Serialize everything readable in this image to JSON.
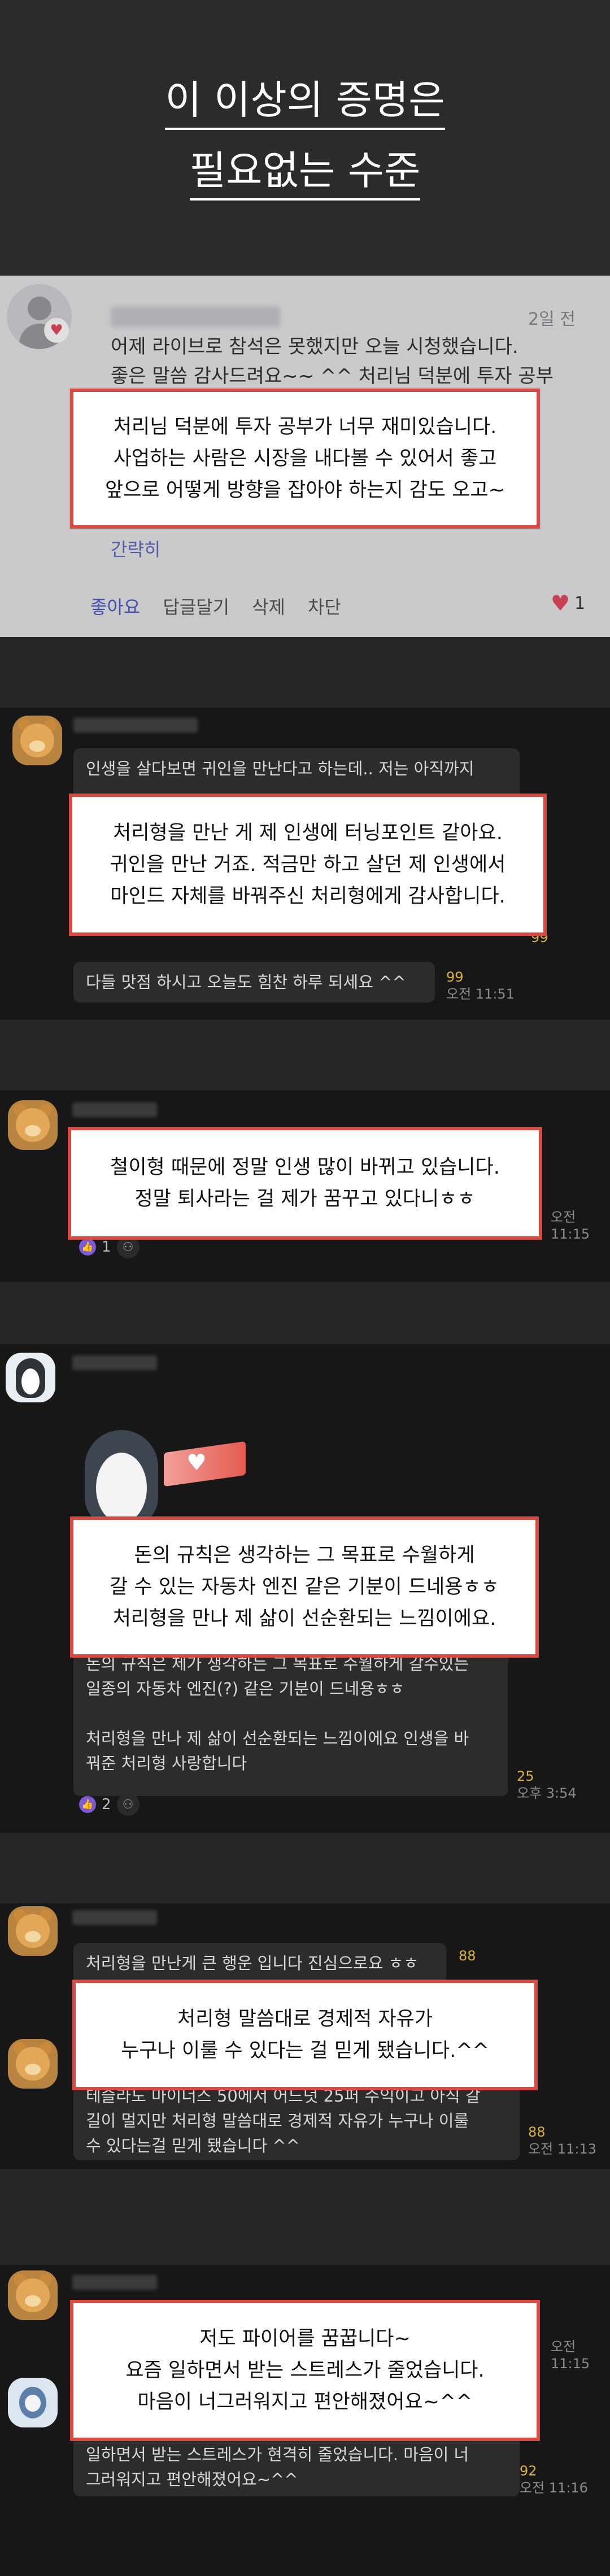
{
  "hero": {
    "line1": "이 이상의 증명은",
    "line2": "필요없는 수준"
  },
  "blog_comment": {
    "date": "2일 전",
    "text_lines": [
      "어제 라이브로 참석은 못했지만 오늘 시청했습니다.",
      "좋은 말씀 감사드려요~~ ^^ 처리님 덕분에 투자 공부",
      "",
      "",
      "",
      ""
    ],
    "fold": "간략히",
    "actions": {
      "like": "좋아요",
      "reply": "답글달기",
      "delete": "삭제",
      "block": "차단"
    },
    "like_count": "1",
    "highlight": [
      "처리님 덕분에 투자 공부가 너무 재미있습니다.",
      "사업하는 사람은 시장을 내다볼 수 있어서 좋고",
      "앞으로 어떻게 방향을 잡아야 하는지 감도 오고~"
    ]
  },
  "chat1": {
    "bubble_top": "인생을 살다보면 귀인을 만난다고 하는데.. 저는 아직까지",
    "count": "99",
    "bubble_bottom": "다들 맛점 하시고 오늘도 힘찬 하루 되세요 ^^",
    "count2": "99",
    "time2": "오전 11:51",
    "highlight": [
      "처리형을 만난 게 제 인생에 터닝포인트 같아요.",
      "귀인을 만난 거죠. 적금만 하고 살던 제 인생에서",
      "마인드 자체를 바꿔주신 처리형에게 감사합니다."
    ]
  },
  "chat2": {
    "time": "오전 11:15",
    "react_count": "1",
    "highlight": [
      "철이형 때문에 정말 인생 많이 바뀌고 있습니다.",
      "정말 퇴사라는 걸 제가 꿈꾸고 있다니ㅎㅎ"
    ]
  },
  "chat3": {
    "bubble_lines": [
      "돈의 규칙은 제가 생각하는 그 목표로 수월하게 갈수있는",
      "일종의 자동차 엔진(?) 같은 기분이 드네용ㅎㅎ",
      "",
      "처리형을 만나 제 삶이 선순환되는 느낌이에요 인생을 바",
      "꿔준 처리형 사랑합니다"
    ],
    "count": "25",
    "time": "오후 3:54",
    "react_count": "2",
    "highlight": [
      "돈의 규칙은 생각하는 그 목표로 수월하게",
      "갈 수 있는 자동차 엔진 같은 기분이 드네용ㅎㅎ",
      "처리형을 만나 제 삶이 선순환되는 느낌이에요."
    ]
  },
  "chat4": {
    "bubble_top": "처리형을 만난게 큰 행운 입니다 진심으로요 ㅎㅎ",
    "count_top": "88",
    "bubble_lines": [
      "테슬라도 마이너스 50에서 어느덧 25퍼 수익이고 아직 갈",
      "길이 멀지만 처리형 말씀대로 경제적 자유가 누구나 이룰",
      "수 있다는걸 믿게 됐습니다 ^^"
    ],
    "count": "88",
    "time": "오전 11:13",
    "highlight": [
      "처리형 말씀대로 경제적 자유가",
      "누구나 이룰 수 있다는 걸 믿게 됐습니다.^^"
    ]
  },
  "chat5": {
    "time_top": "오전 11:15",
    "bubble_lines": [
      "일하면서 받는 스트레스가 현격히 줄었습니다. 마음이 너",
      "그러워지고 편안해졌어요~^^"
    ],
    "count": "92",
    "time": "오전 11:16",
    "highlight": [
      "저도 파이어를 꿈꿉니다~",
      "요즘 일하면서 받는 스트레스가 줄었습니다.",
      "마음이 너그러워지고 편안해졌어요~^^"
    ]
  },
  "colors": {
    "accent_red": "#d94a43",
    "count_yellow": "#d9b23a",
    "like_blue": "#4a5bc9"
  }
}
